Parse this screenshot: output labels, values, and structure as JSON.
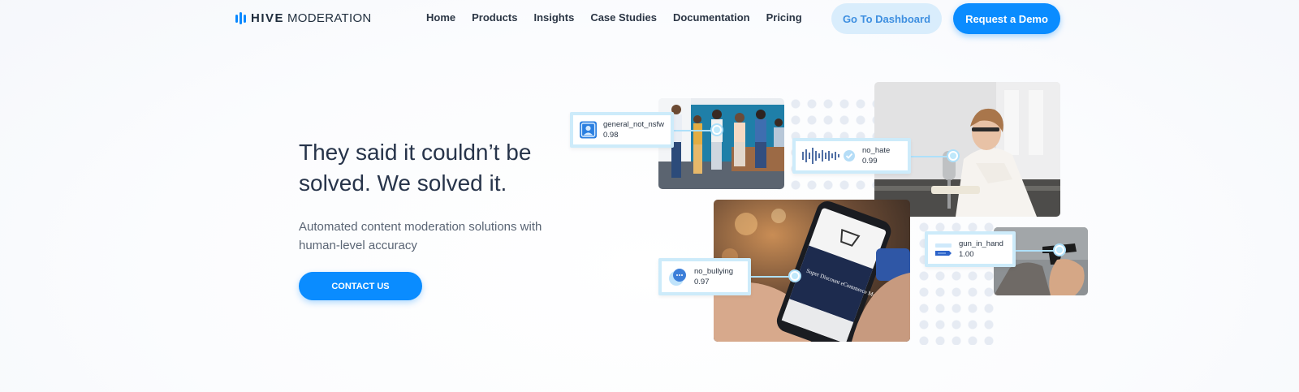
{
  "nav": {
    "logo_bold": "HIVE",
    "logo_light": "MODERATION",
    "links": [
      "Home",
      "Products",
      "Insights",
      "Case Studies",
      "Documentation",
      "Pricing"
    ],
    "dashboard_label": "Go To Dashboard",
    "demo_label": "Request a Demo"
  },
  "hero": {
    "title": "They said it couldn’t be solved. We solved it.",
    "subtitle": "Automated content moderation solutions with human-level accuracy",
    "cta_label": "CONTACT US"
  },
  "tags": [
    {
      "class": "general_not_nsfw",
      "score": "0.98",
      "icon": "person-image-icon"
    },
    {
      "class": "no_hate",
      "score": "0.99",
      "icon": "audio-waveform-icon"
    },
    {
      "class": "gun_in_hand",
      "score": "1.00",
      "icon": "gun-icon"
    },
    {
      "class": "no_bullying",
      "score": "0.97",
      "icon": "chat-bubble-icon"
    }
  ],
  "images": {
    "phone_screen_text": "Super Discount eCommerce Market"
  },
  "colors": {
    "accent": "#0a8cff",
    "dashboard_bg": "#d9edfc",
    "tag_border": "#cdebfa",
    "title_text": "#27344a"
  }
}
